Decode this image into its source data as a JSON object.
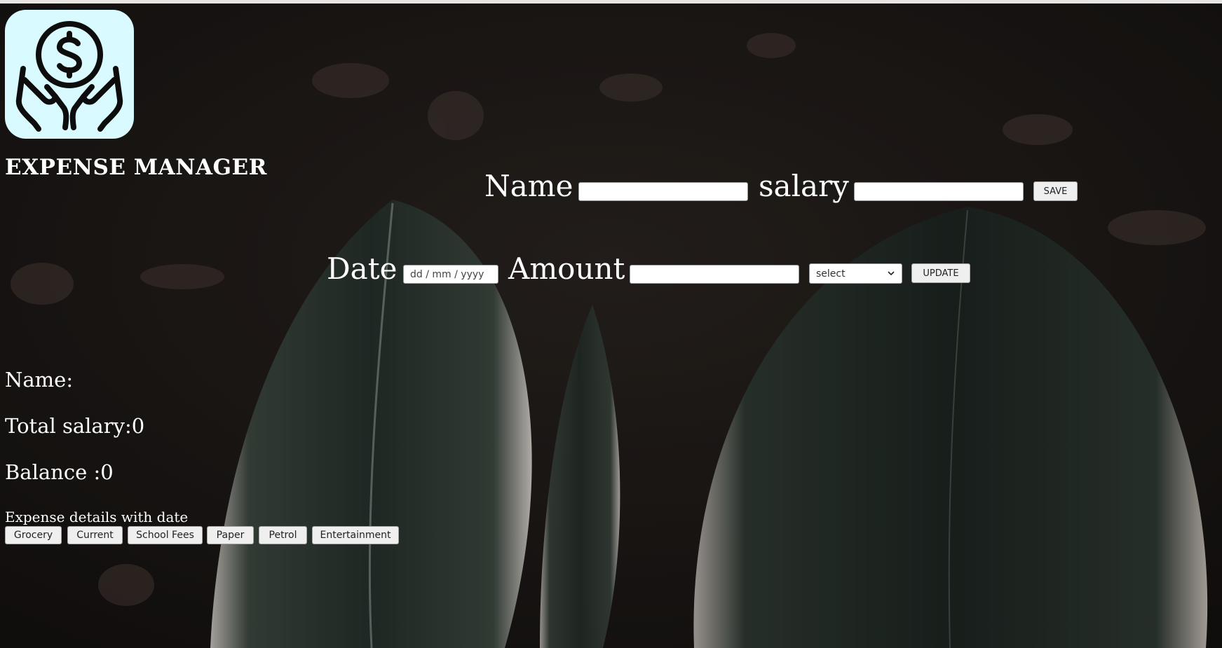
{
  "app": {
    "title": "EXPENSE MANAGER",
    "logo_icon": "hands-holding-dollar-icon",
    "logo_bg_color": "#d9fbff"
  },
  "salary_form": {
    "name_label": "Name",
    "name_value": "",
    "salary_label": "salary",
    "salary_value": "",
    "save_label": "SAVE"
  },
  "expense_form": {
    "date_label": "Date",
    "date_placeholder": "dd / mm / yyyy",
    "amount_label": "Amount",
    "amount_value": "",
    "category_selected": "select",
    "update_label": "UPDATE"
  },
  "summary": {
    "name_text": "Name:",
    "total_salary_text": "Total salary:0",
    "balance_text": "Balance :0"
  },
  "expense_details": {
    "heading": "Expense details with date",
    "categories": [
      "Grocery",
      "Current",
      "School Fees",
      "Paper",
      "Petrol",
      "Entertainment"
    ]
  }
}
